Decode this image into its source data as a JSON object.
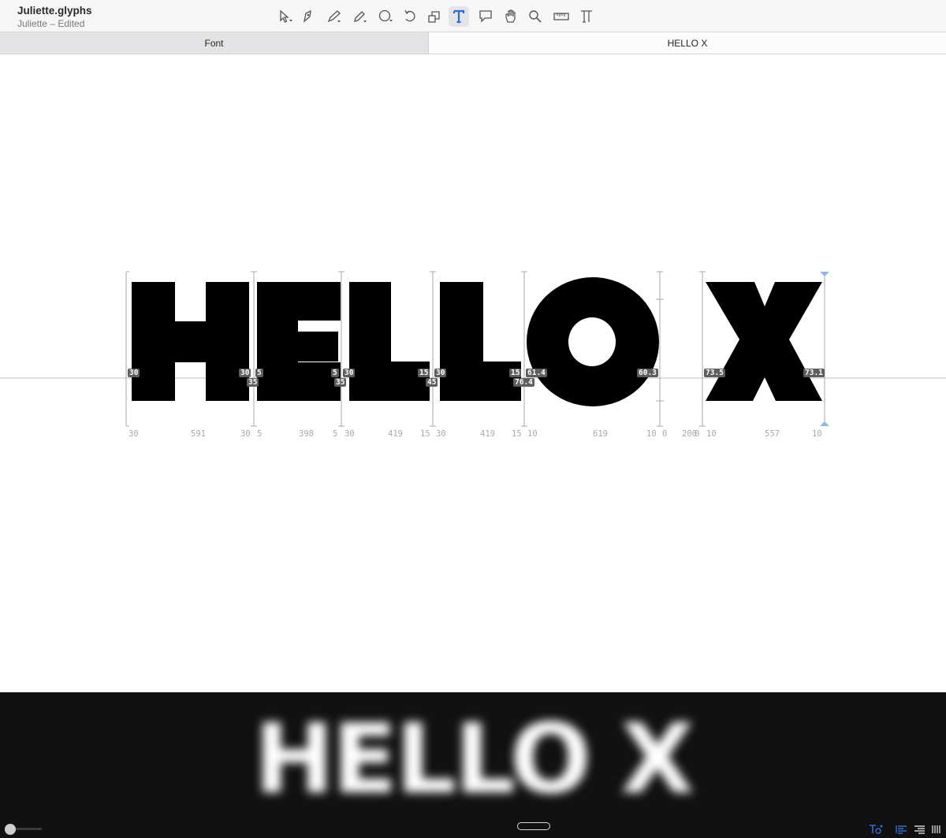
{
  "window": {
    "title": "Juliette.glyphs",
    "subtitle": "Juliette – Edited"
  },
  "toolbar": {
    "tools": [
      {
        "name": "select-tool-icon"
      },
      {
        "name": "annotate-tool-icon"
      },
      {
        "name": "draw-tool-icon"
      },
      {
        "name": "pencil-tool-icon"
      },
      {
        "name": "shape-tool-icon"
      },
      {
        "name": "rotate-tool-icon"
      },
      {
        "name": "scale-tool-icon"
      },
      {
        "name": "text-tool-icon",
        "active": true
      },
      {
        "name": "comment-tool-icon"
      },
      {
        "name": "hand-tool-icon"
      },
      {
        "name": "zoom-tool-icon"
      },
      {
        "name": "measure-tool-icon"
      },
      {
        "name": "type-tool-icon"
      }
    ],
    "active_color": "#2b6fd6"
  },
  "tabs": [
    {
      "label": "Font",
      "active": false
    },
    {
      "label": "HELLO X",
      "active": true
    }
  ],
  "editor": {
    "text": "HELLO X",
    "glyphs": [
      {
        "char": "H",
        "lsb": "30",
        "width": "591",
        "rsb": "30",
        "left_kern": "30",
        "right_kern": "30",
        "right_kern2": "35"
      },
      {
        "char": "E",
        "lsb": "5",
        "width": "398",
        "rsb": "5",
        "left_kern": "5",
        "right_kern": "5",
        "right_kern2": "35"
      },
      {
        "char": "L",
        "lsb": "30",
        "width": "419",
        "rsb": "15",
        "left_kern": "30",
        "right_kern": "15",
        "right_kern2": "45"
      },
      {
        "char": "L",
        "lsb": "30",
        "width": "419",
        "rsb": "15",
        "left_kern": "30",
        "right_kern": "15",
        "right_kern2": "76.4"
      },
      {
        "char": "O",
        "lsb": "10",
        "width": "619",
        "rsb": "10",
        "left_kern": "61.4",
        "right_kern": "60.3"
      },
      {
        "char": "space",
        "lsb": "0",
        "width": "200",
        "rsb": "0"
      },
      {
        "char": "X",
        "lsb": "10",
        "width": "557",
        "rsb": "10",
        "left_kern": "73.5",
        "right_kern": "73.1"
      }
    ]
  },
  "preview": {
    "text": "HELLO X"
  },
  "colors": {
    "accent": "#2b6fd6",
    "preview_bg": "#111111"
  }
}
